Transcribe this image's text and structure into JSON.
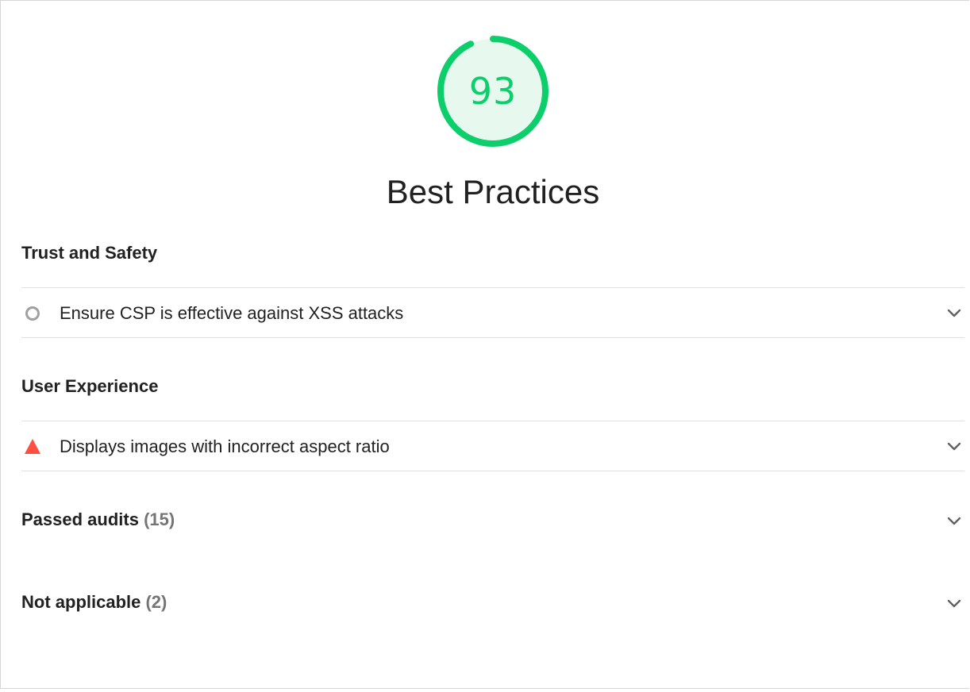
{
  "gauge": {
    "score": "93",
    "fraction": 0.93,
    "color": "#0cce6b",
    "fill_color": "#e7f9ef"
  },
  "category": {
    "title": "Best Practices"
  },
  "groups": [
    {
      "title": "Trust and Safety",
      "audits": [
        {
          "label": "Ensure CSP is effective against XSS attacks",
          "status": "informative",
          "icon": "circle-outline-icon"
        }
      ]
    },
    {
      "title": "User Experience",
      "audits": [
        {
          "label": "Displays images with incorrect aspect ratio",
          "status": "fail",
          "icon": "red-triangle-icon",
          "color": "#ff4e42"
        }
      ]
    }
  ],
  "passed": {
    "label": "Passed audits",
    "count": "(15)"
  },
  "not_applicable": {
    "label": "Not applicable",
    "count": "(2)"
  },
  "colors": {
    "pass": "#0cce6b",
    "fail": "#ff4e42",
    "muted": "#757575",
    "divider": "#e0e0e0"
  }
}
